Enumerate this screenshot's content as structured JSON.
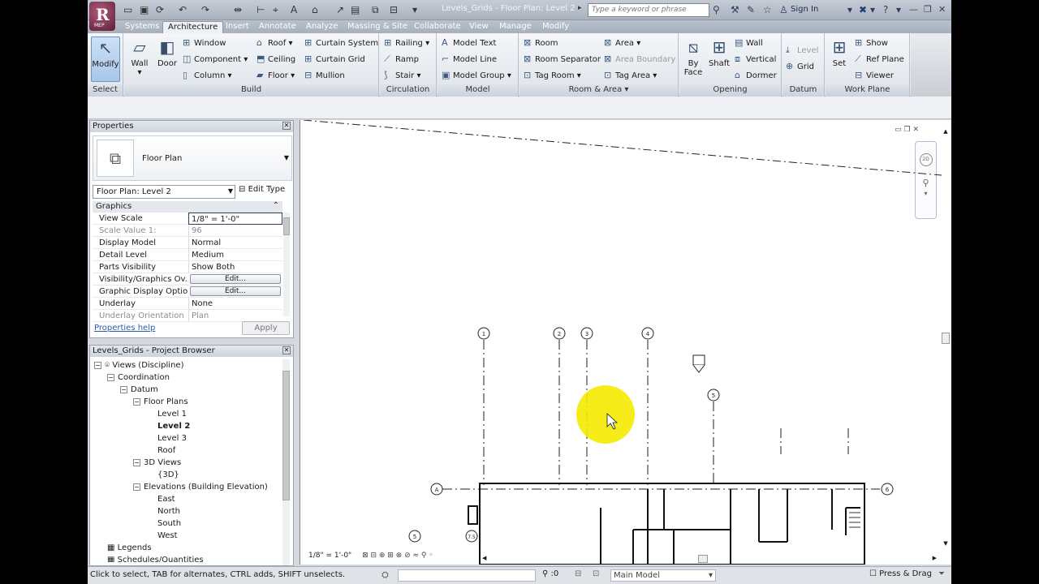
{
  "title": {
    "doc": "Levels_Grids - Floor Plan: Level 2",
    "search_placeholder": "Type a keyword or phrase",
    "sign_in": "Sign In",
    "app_badge": "MEP"
  },
  "tabs": [
    "Systems",
    "Architecture",
    "Insert",
    "Annotate",
    "Analyze",
    "Massing & Site",
    "Collaborate",
    "View",
    "Manage",
    "Modify"
  ],
  "ribbon": {
    "select": {
      "label": "Select",
      "modify": "Modify"
    },
    "build": {
      "label": "Build",
      "wall": "Wall",
      "door": "Door",
      "window": "Window",
      "component": "Component",
      "column": "Column",
      "roof": "Roof",
      "ceiling": "Ceiling",
      "floor": "Floor",
      "curtain_system": "Curtain System",
      "curtain_grid": "Curtain Grid",
      "mullion": "Mullion"
    },
    "circulation": {
      "label": "Circulation",
      "railing": "Railing",
      "ramp": "Ramp",
      "stair": "Stair"
    },
    "model": {
      "label": "Model",
      "text": "Model Text",
      "line": "Model Line",
      "group": "Model Group"
    },
    "room": {
      "label": "Room & Area",
      "room": "Room",
      "separator": "Room Separator",
      "tag_room": "Tag Room",
      "area": "Area",
      "area_boundary": "Area Boundary",
      "tag_area": "Tag Area"
    },
    "opening": {
      "label": "Opening",
      "by_face_1": "By",
      "by_face_2": "Face",
      "shaft": "Shaft",
      "wall": "Wall",
      "vertical": "Vertical",
      "dormer": "Dormer"
    },
    "datum": {
      "label": "Datum",
      "level": "Level",
      "grid": "Grid"
    },
    "workplane": {
      "label": "Work Plane",
      "set": "Set",
      "show": "Show",
      "ref_plane": "Ref Plane",
      "viewer": "Viewer"
    }
  },
  "properties": {
    "title": "Properties",
    "type_name": "Floor Plan",
    "instance": "Floor Plan: Level 2",
    "edit_type": "Edit Type",
    "group": "Graphics",
    "rows": [
      {
        "k": "View Scale",
        "v": "1/8\" = 1'-0\""
      },
      {
        "k": "Scale Value    1:",
        "v": "96"
      },
      {
        "k": "Display Model",
        "v": "Normal"
      },
      {
        "k": "Detail Level",
        "v": "Medium"
      },
      {
        "k": "Parts Visibility",
        "v": "Show Both"
      },
      {
        "k": "Visibility/Graphics Ov...",
        "v": "Edit..."
      },
      {
        "k": "Graphic Display Options",
        "v": "Edit..."
      },
      {
        "k": "Underlay",
        "v": "None"
      },
      {
        "k": "Underlay Orientation",
        "v": "Plan"
      }
    ],
    "help": "Properties help",
    "apply": "Apply"
  },
  "browser": {
    "title": "Levels_Grids - Project Browser",
    "views": "Views (Discipline)",
    "coordination": "Coordination",
    "datum": "Datum",
    "floor_plans": "Floor Plans",
    "level1": "Level 1",
    "level2": "Level 2",
    "level3": "Level 3",
    "roof": "Roof",
    "views3d": "3D Views",
    "view3d": "{3D}",
    "elevations": "Elevations (Building Elevation)",
    "east": "East",
    "north": "North",
    "south": "South",
    "west": "West",
    "legends": "Legends",
    "schedules": "Schedules/Quantities"
  },
  "canvas": {
    "scale": "1/8\" = 1'-0\"",
    "grids": [
      "1",
      "2",
      "3",
      "4",
      "5",
      "A",
      "6",
      "5",
      "7.5"
    ]
  },
  "status": {
    "message": "Click to select, TAB for alternates, CTRL adds, SHIFT unselects.",
    "count": ":0",
    "model": "Main Model",
    "press_drag": "Press & Drag"
  }
}
